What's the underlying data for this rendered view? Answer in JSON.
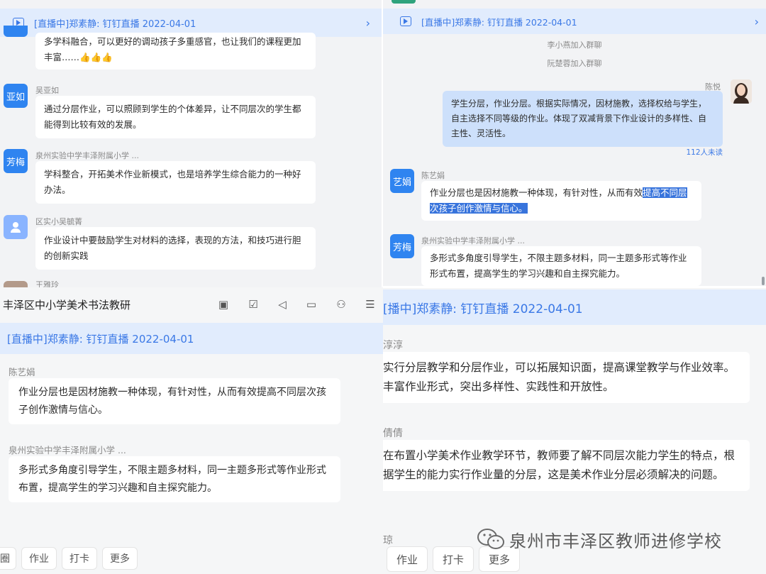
{
  "live_title": "[直播中]郑素静: 钉钉直播 2022-04-01",
  "top_left": {
    "messages": [
      {
        "text": "多学科融合，可以更好的调动孩子多重感官，也让我们的课程更加丰富……👍👍👍"
      },
      {
        "name": "吴亚如",
        "avatar": "亚如",
        "text": "通过分层作业，可以照顾到学生的个体差异，让不同层次的学生都能得到比较有效的发展。"
      },
      {
        "name": "泉州实验中学丰泽附属小学 ...",
        "avatar": "芳梅",
        "text": "学科整合，开拓美术作业新模式，也是培养学生综合能力的一种好办法。"
      },
      {
        "name": "区实小吴毓菁",
        "text": "作业设计中要鼓励学生对材料的选择，表现的方法，和技巧进行胆的创新实践"
      },
      {
        "name": "王雅玲"
      }
    ]
  },
  "top_right": {
    "system": [
      "李小燕加入群聊",
      "阮楚蓉加入群聊"
    ],
    "self": {
      "name": "陈悦",
      "text": "学生分层，作业分层。根据实际情况，因材施教，选择权给与学生，自主选择不同等级的作业。体现了双减背景下作业设计的多样性、自主性、灵活性。",
      "unread": "112人未读"
    },
    "messages": [
      {
        "name": "陈艺娟",
        "avatar": "艺娟",
        "text_plain": "作业分层也是因材施教一种体现，有针对性，从而有效",
        "text_highlight": "提高不同层次孩子创作激情与信心。"
      },
      {
        "name": "泉州实验中学丰泽附属小学 ...",
        "avatar": "芳梅",
        "text": "多形式多角度引导学生，不限主题多材料，同一主题多形式等作业形式布置，提高学生的学习兴趣和自主探究能力。"
      }
    ]
  },
  "bottom_left": {
    "group_title": "丰泽区中小学美术书法教研",
    "toolbar_icons": [
      "video-icon",
      "checkbox-icon",
      "speaker-icon",
      "folder-icon",
      "add-member-icon",
      "search-list-icon"
    ],
    "messages": [
      {
        "name": "陈艺娟",
        "text": "作业分层也是因材施教一种体现，有针对性，从而有效提高不同层次孩子创作激情与信心。"
      },
      {
        "name": "泉州实验中学丰泽附属小学 ...",
        "text": "多形式多角度引导学生，不限主题多材料，同一主题多形式等作业形式布置，提高学生的学习兴趣和自主探究能力。"
      }
    ],
    "buttons": [
      "圈",
      "作业",
      "打卡",
      "更多"
    ]
  },
  "bottom_right": {
    "live_title": "[播中]郑素静: 钉钉直播 2022-04-01",
    "messages": [
      {
        "name": "淳淳",
        "text": "实行分层教学和分层作业，可以拓展知识面，提高课堂教学与作业效率。丰富作业形式，突出多样性、实践性和开放性。"
      },
      {
        "name": "倩倩",
        "text": "在布置小学美术作业教学环节，教师要了解不同层次能力学生的特点，根据学生的能力实行作业量的分层，这是美术作业分层必须解决的问题。"
      },
      {
        "name": "琼"
      }
    ],
    "buttons": [
      "作业",
      "打卡",
      "更多"
    ]
  },
  "watermark": "泉州市丰泽区教师进修学校"
}
